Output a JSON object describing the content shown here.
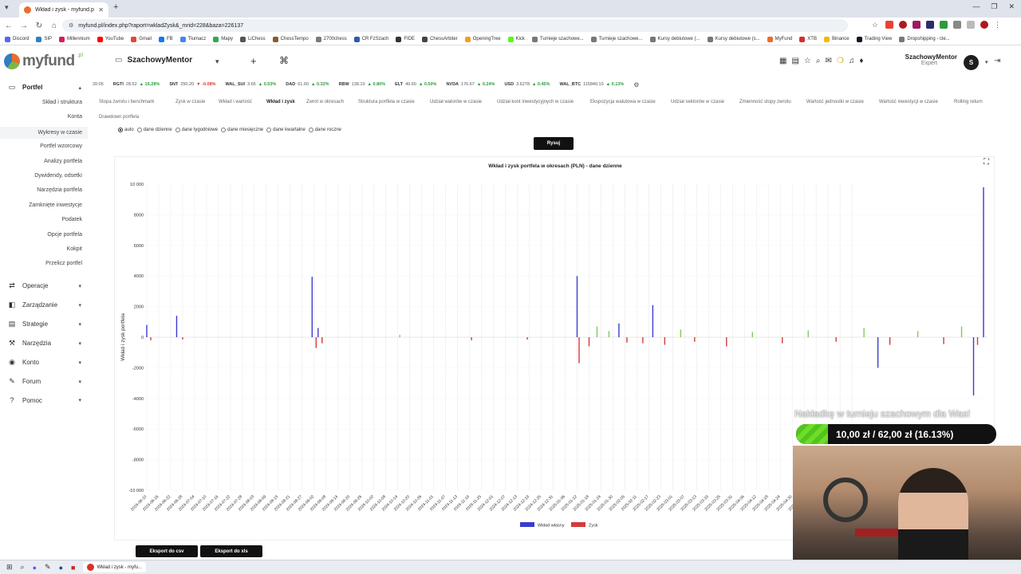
{
  "browser": {
    "tab_title": "Wkład i zysk - myfund.pl",
    "url": "myfund.pl/index.php?raport=wkladZysk&_mrid=228&baza=226137",
    "bookmarks": [
      "Discord",
      "SIP",
      "Millennium",
      "YouTube",
      "Gmail",
      "FB",
      "Tłumacz",
      "Mapy",
      "LiChess",
      "ChessTempo",
      "2700chess",
      "CR FzSzach",
      "FIDE",
      "ChessArbiter",
      "OpeningTree",
      "Kick",
      "Turnieje szachowe...",
      "Turnieje szachowe...",
      "Kursy debiutowe (...",
      "Kursy debiutowe (s...",
      "MyFund",
      "XTB",
      "Binance",
      "Trading View",
      "Dropshipping - cle..."
    ],
    "bookmark_colors": [
      "#5865f2",
      "#2f7ec1",
      "#d81b60",
      "#ff0000",
      "#ea4335",
      "#1877f2",
      "#4285f4",
      "#34a853",
      "#555555",
      "#8b5a2b",
      "#7a7a7a",
      "#2e5aa8",
      "#333333",
      "#444444",
      "#f0a020",
      "#53fc18",
      "#777777",
      "#777777",
      "#777777",
      "#777777",
      "#e96d2c",
      "#d32f2f",
      "#f0b90b",
      "#131722",
      "#777777"
    ]
  },
  "header": {
    "logo_text": "myfund",
    "logo_suffix": ".pl",
    "portfolio_name": "SzachowyMentor",
    "add_icon": "+",
    "cmd_icon": "⌘",
    "user_name": "SzachowyMentor",
    "user_role": "Expert",
    "avatar_letter": "S"
  },
  "sidebar": {
    "portfel_label": "Portfel",
    "sub_items": [
      "Skład i struktura",
      "Konta",
      "Wykresy w czasie",
      "Portfel wzorcowy",
      "Analizy portfela",
      "Dywidendy, odsetki",
      "Narzędzia portfela",
      "Zamknięte inwestycje",
      "Podatek",
      "Opcje portfela",
      "Kokpit",
      "Przelicz portfel"
    ],
    "active_sub": "Wykresy w czasie",
    "main_items": [
      "Operacje",
      "Zarządzanie",
      "Strategie",
      "Narzędzia",
      "Konto",
      "Forum",
      "Pomoc"
    ]
  },
  "ticker": {
    "time": "20:05",
    "items": [
      {
        "sym": "RGTI",
        "price": "28.52",
        "chg": "15.28",
        "dir": "up"
      },
      {
        "sym": "SNT",
        "price": "250.20",
        "chg": "-0.08",
        "dir": "dn"
      },
      {
        "sym": "WAL_SUI",
        "price": "3.65",
        "chg": "0.53",
        "dir": "up"
      },
      {
        "sym": "DAD",
        "price": "61.60",
        "chg": "0.32",
        "dir": "up"
      },
      {
        "sym": "RBW",
        "price": "138.10",
        "chg": "0.80",
        "dir": "up"
      },
      {
        "sym": "ELT",
        "price": "49.60",
        "chg": "0.50",
        "dir": "up"
      },
      {
        "sym": "NVDA",
        "price": "176.67",
        "chg": "0.24",
        "dir": "up"
      },
      {
        "sym": "USD",
        "price": "3.6278",
        "chg": "0.45",
        "dir": "up"
      },
      {
        "sym": "WAL_BTC",
        "price": "115840.10",
        "chg": "0.13",
        "dir": "up"
      }
    ]
  },
  "report_tabs": [
    "Stopa zwrotu i benchmark",
    "Zysk w czasie",
    "Wkład i wartość",
    "Wkład i zysk",
    "Zwrot w okresach",
    "Struktura portfela w czasie",
    "Udział walorów w czasie",
    "Udział kont inwestycyjnych w czasie",
    "Ekspozycja walutowa w czasie",
    "Udział sektorów w czasie",
    "Zmienność stopy zwrotu",
    "Wartość jednostki w czasie",
    "Wartość inwestycji w czasie",
    "Rolling return",
    "Drawdown portfela"
  ],
  "active_tab": "Wkład i zysk",
  "radios": [
    "auto",
    "dane dzienne",
    "dane tygodniowe",
    "dane miesięczne",
    "dane kwartalne",
    "dane roczne"
  ],
  "radio_selected": "auto",
  "draw_button": "Rysuj",
  "export_csv": "Eksport do csv",
  "export_xls": "Eksport do xls",
  "overlay": {
    "watermark": "Nakładkę w turnieju szachowym dla Was!",
    "goal_text": "10,00 zł / 62,00 zł (16.13%)",
    "goal_fraction": 0.1613
  },
  "taskbar": {
    "app_label": "Wkład i zysk - myfu..."
  },
  "colors": {
    "contribution": "#3b3bcf",
    "profit_pos": "#7ecb5a",
    "profit_neg": "#d23b3b",
    "accent_dark": "#111111"
  },
  "chart_data": {
    "type": "bar",
    "title": "Wkład i zysk portfela w okresach (PLN) - dane dzienne",
    "ylabel": "Wkład i zysk portfela",
    "ylim": [
      -10000,
      10000
    ],
    "yticks": [
      "10 000",
      "8000",
      "6000",
      "4000",
      "2000",
      "0",
      "-2000",
      "-4000",
      "-6000",
      "-8000",
      "-10 000"
    ],
    "ytick_values": [
      10000,
      8000,
      6000,
      4000,
      2000,
      0,
      -2000,
      -4000,
      -6000,
      -8000,
      -10000
    ],
    "x_start": "2024-06-10",
    "x_end": "2025-08-06",
    "x_tick_labels": [
      "2024-06-10",
      "2024-06-16",
      "2024-06-22",
      "2024-06-28",
      "2024-07-04",
      "2024-07-10",
      "2024-07-16",
      "2024-07-22",
      "2024-07-28",
      "2024-08-03",
      "2024-08-09",
      "2024-08-15",
      "2024-08-21",
      "2024-08-27",
      "2024-09-02",
      "2024-09-08",
      "2024-09-14",
      "2024-09-20",
      "2024-09-26",
      "2024-10-02",
      "2024-10-08",
      "2024-10-14",
      "2024-10-20",
      "2024-10-26",
      "2024-11-01",
      "2024-11-07",
      "2024-11-13",
      "2024-11-19",
      "2024-11-25",
      "2024-12-01",
      "2024-12-07",
      "2024-12-13",
      "2024-12-19",
      "2024-12-25",
      "2024-12-31",
      "2025-01-06",
      "2025-01-12",
      "2025-01-18",
      "2025-01-24",
      "2025-01-30",
      "2025-02-05",
      "2025-02-11",
      "2025-02-17",
      "2025-02-23",
      "2025-03-01",
      "2025-03-07",
      "2025-03-13",
      "2025-03-19",
      "2025-03-25",
      "2025-03-31",
      "2025-04-06",
      "2025-04-12",
      "2025-04-18",
      "2025-04-24",
      "2025-04-30",
      "2025-05-06",
      "2025-05-12",
      "2025-05-18",
      "2025-05-24",
      "2025-05-30"
    ],
    "legend": [
      "Wkład własny",
      "Zysk"
    ],
    "legend_position": "bottom-center",
    "series": [
      {
        "name": "Wkład własny",
        "points": [
          [
            "2024-06-10",
            800
          ],
          [
            "2024-06-25",
            1400
          ],
          [
            "2024-09-01",
            3950
          ],
          [
            "2024-09-04",
            600
          ],
          [
            "2025-01-12",
            4000
          ],
          [
            "2025-02-02",
            900
          ],
          [
            "2025-02-19",
            2100
          ],
          [
            "2025-06-12",
            -2000
          ],
          [
            "2025-07-30",
            -3800
          ],
          [
            "2025-08-04",
            9800
          ]
        ]
      },
      {
        "name": "Zysk",
        "points": [
          [
            "2024-06-12",
            -200
          ],
          [
            "2024-06-28",
            -150
          ],
          [
            "2024-09-03",
            -700
          ],
          [
            "2024-09-06",
            -400
          ],
          [
            "2024-10-15",
            150
          ],
          [
            "2024-11-20",
            -200
          ],
          [
            "2024-12-18",
            -150
          ],
          [
            "2025-01-13",
            -1700
          ],
          [
            "2025-01-18",
            -600
          ],
          [
            "2025-01-22",
            700
          ],
          [
            "2025-01-28",
            400
          ],
          [
            "2025-02-06",
            -350
          ],
          [
            "2025-02-14",
            -400
          ],
          [
            "2025-02-25",
            -500
          ],
          [
            "2025-03-05",
            500
          ],
          [
            "2025-03-12",
            -300
          ],
          [
            "2025-03-28",
            -600
          ],
          [
            "2025-04-10",
            350
          ],
          [
            "2025-04-25",
            -400
          ],
          [
            "2025-05-08",
            450
          ],
          [
            "2025-05-22",
            -300
          ],
          [
            "2025-06-05",
            600
          ],
          [
            "2025-06-18",
            -500
          ],
          [
            "2025-07-02",
            400
          ],
          [
            "2025-07-15",
            -450
          ],
          [
            "2025-07-24",
            700
          ],
          [
            "2025-08-01",
            -500
          ]
        ]
      }
    ]
  }
}
